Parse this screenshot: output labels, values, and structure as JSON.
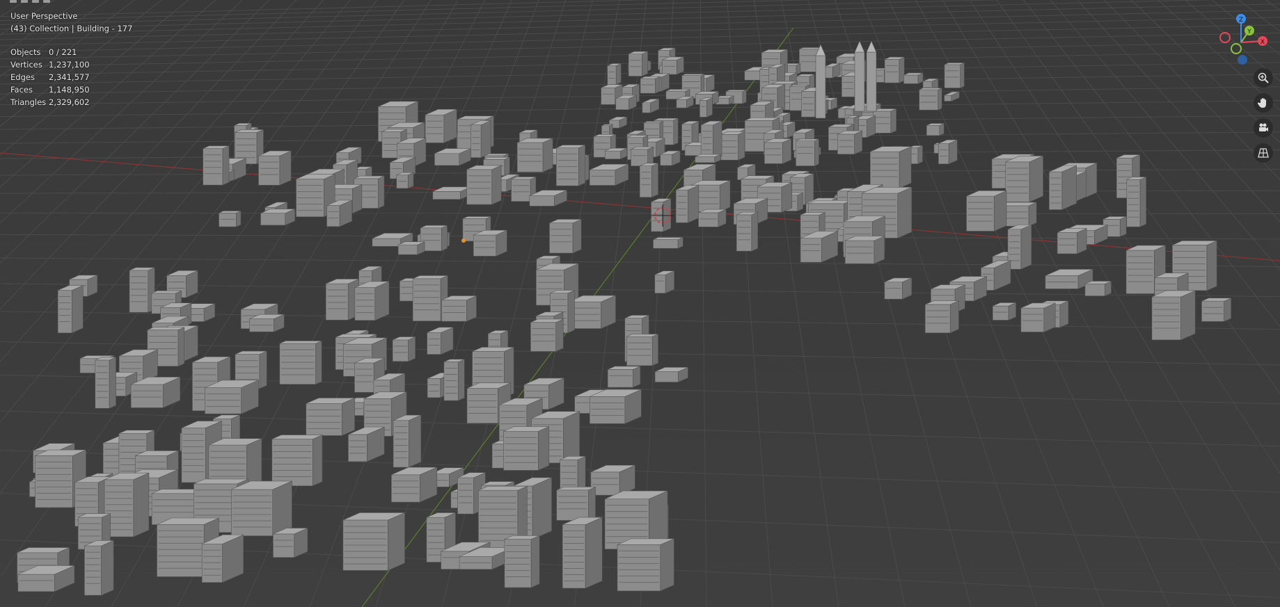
{
  "viewport": {
    "view_name": "User Perspective",
    "collection_line": "(43) Collection | Building - 177",
    "stats": [
      {
        "label": "Objects",
        "value": "0 / 221"
      },
      {
        "label": "Vertices",
        "value": "1,237,100"
      },
      {
        "label": "Edges",
        "value": "2,341,577"
      },
      {
        "label": "Faces",
        "value": "1,148,950"
      },
      {
        "label": "Triangles",
        "value": "2,329,602"
      }
    ]
  },
  "gizmo": {
    "z_label": "Z",
    "y_label": "Y",
    "x_label": "X",
    "colors": {
      "x": "#e8475a",
      "y": "#8ac43f",
      "z": "#3b8ef0",
      "grid": "#4a4a4a",
      "red_axis": "#9b3a3a",
      "green_axis": "#5f8a2a"
    }
  },
  "nav": [
    {
      "name": "zoom-icon"
    },
    {
      "name": "pan-hand-icon"
    },
    {
      "name": "camera-icon"
    },
    {
      "name": "grid-view-icon"
    }
  ]
}
